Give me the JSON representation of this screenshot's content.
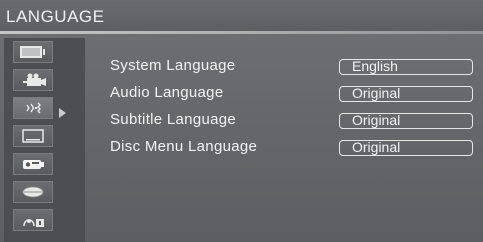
{
  "header": {
    "title": "LANGUAGE"
  },
  "sidebar": {
    "items": [
      {
        "icon": "tv-screen-icon",
        "active": false
      },
      {
        "icon": "video-camera-icon",
        "active": false
      },
      {
        "icon": "audio-speaker-icon",
        "active": true
      },
      {
        "icon": "display-frame-icon",
        "active": false
      },
      {
        "icon": "projector-icon",
        "active": false
      },
      {
        "icon": "disc-icon",
        "active": false
      },
      {
        "icon": "parental-lock-icon",
        "active": false
      }
    ]
  },
  "settings": {
    "rows": [
      {
        "label": "System Language",
        "value": "English"
      },
      {
        "label": "Audio Language",
        "value": "Original"
      },
      {
        "label": "Subtitle Language",
        "value": "Original"
      },
      {
        "label": "Disc Menu Language",
        "value": "Original"
      }
    ]
  },
  "colors": {
    "panel_background": "#636568",
    "sidebar_background": "#4c4e51",
    "text": "#f2f2f2",
    "box_border": "#e6e6e6"
  }
}
